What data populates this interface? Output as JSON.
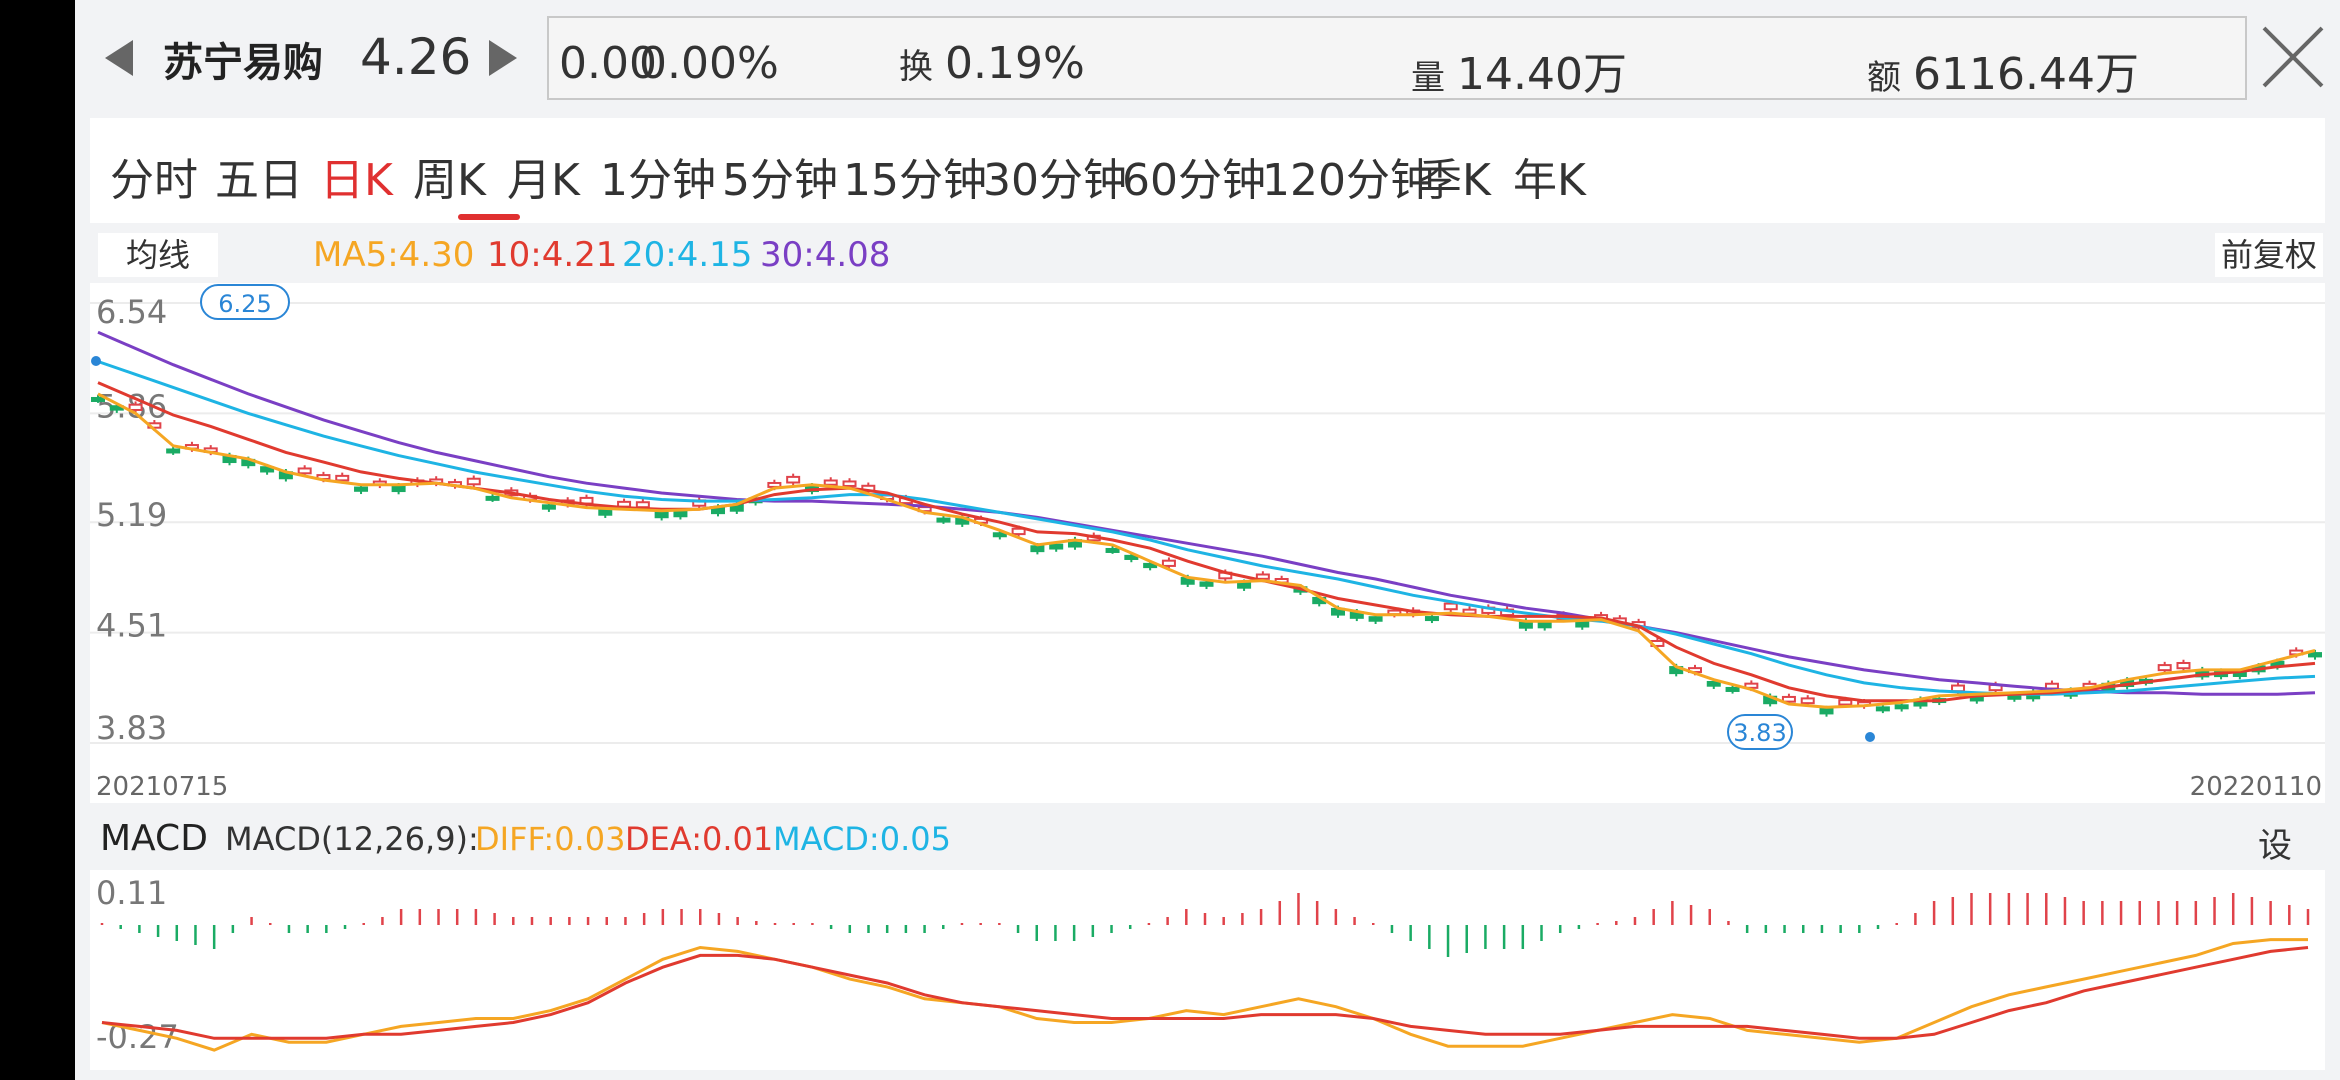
{
  "header": {
    "stock_name": "苏宁易购",
    "price": "4.26",
    "change": "0.00",
    "change_pct": "0.00%",
    "turnover_label": "换",
    "turnover": "0.19%",
    "volume_label": "量",
    "volume": "14.40万",
    "amount_label": "额",
    "amount": "6116.44万"
  },
  "tabs": [
    {
      "label": "分时"
    },
    {
      "label": "五日"
    },
    {
      "label": "日K"
    },
    {
      "label": "周K"
    },
    {
      "label": "月K"
    },
    {
      "label": "1分钟"
    },
    {
      "label": "5分钟"
    },
    {
      "label": "15分钟"
    },
    {
      "label": "30分钟"
    },
    {
      "label": "60分钟"
    },
    {
      "label": "120分钟"
    },
    {
      "label": "季K"
    },
    {
      "label": "年K"
    }
  ],
  "active_tab": "日K",
  "ma_legend": {
    "button": "均线",
    "ma5": "MA5:4.30",
    "ma10": "10:4.21",
    "ma20": "20:4.15",
    "ma30": "30:4.08",
    "adjust": "前复权"
  },
  "colors": {
    "ma5": "#f5a623",
    "ma10": "#e03a2f",
    "ma20": "#1eb4e4",
    "ma30": "#7a3fc4",
    "up": "#e0434a",
    "down": "#1aab64",
    "diff": "#f5a623",
    "dea": "#e03a2f",
    "macd": "#1eb4e4"
  },
  "macd_legend": {
    "title": "MACD",
    "params": "MACD(12,26,9):",
    "diff": "DIFF:0.03",
    "dea": "DEA:0.01",
    "macd": "MACD:0.05",
    "settings": "设置"
  },
  "chart_data": {
    "type": "candlestick",
    "y_ticks": [
      "6.54",
      "5.86",
      "5.19",
      "4.51",
      "3.83"
    ],
    "ylim": [
      3.83,
      6.54
    ],
    "x_start": "20210715",
    "x_end": "20220110",
    "max_marker": "6.25",
    "min_marker": "3.83",
    "ma5": [
      5.98,
      5.86,
      5.66,
      5.62,
      5.58,
      5.5,
      5.45,
      5.42,
      5.42,
      5.43,
      5.4,
      5.34,
      5.31,
      5.28,
      5.27,
      5.26,
      5.27,
      5.3,
      5.4,
      5.42,
      5.4,
      5.33,
      5.25,
      5.22,
      5.14,
      5.05,
      5.08,
      5.05,
      4.95,
      4.85,
      4.82,
      4.83,
      4.8,
      4.66,
      4.62,
      4.62,
      4.63,
      4.61,
      4.58,
      4.58,
      4.59,
      4.52,
      4.3,
      4.22,
      4.16,
      4.07,
      4.05,
      4.06,
      4.08,
      4.12,
      4.13,
      4.14,
      4.15,
      4.17,
      4.22,
      4.26,
      4.28,
      4.28,
      4.34,
      4.4
    ],
    "ma10": [
      6.05,
      5.95,
      5.85,
      5.78,
      5.7,
      5.62,
      5.56,
      5.5,
      5.46,
      5.43,
      5.4,
      5.37,
      5.33,
      5.3,
      5.28,
      5.27,
      5.27,
      5.3,
      5.36,
      5.39,
      5.4,
      5.37,
      5.3,
      5.24,
      5.19,
      5.13,
      5.12,
      5.08,
      5.03,
      4.95,
      4.88,
      4.83,
      4.78,
      4.72,
      4.68,
      4.64,
      4.62,
      4.61,
      4.61,
      4.61,
      4.6,
      4.55,
      4.42,
      4.32,
      4.25,
      4.17,
      4.12,
      4.09,
      4.09,
      4.09,
      4.12,
      4.13,
      4.14,
      4.16,
      4.19,
      4.22,
      4.25,
      4.27,
      4.3,
      4.32
    ],
    "ma20": [
      6.18,
      6.1,
      6.02,
      5.94,
      5.86,
      5.79,
      5.72,
      5.66,
      5.6,
      5.55,
      5.5,
      5.46,
      5.42,
      5.38,
      5.35,
      5.33,
      5.32,
      5.32,
      5.33,
      5.34,
      5.36,
      5.36,
      5.33,
      5.29,
      5.25,
      5.21,
      5.17,
      5.13,
      5.08,
      5.02,
      4.97,
      4.92,
      4.88,
      4.84,
      4.79,
      4.74,
      4.7,
      4.66,
      4.63,
      4.6,
      4.58,
      4.55,
      4.5,
      4.44,
      4.38,
      4.31,
      4.25,
      4.2,
      4.17,
      4.15,
      4.14,
      4.13,
      4.13,
      4.14,
      4.15,
      4.17,
      4.19,
      4.21,
      4.23,
      4.24
    ],
    "ma30": [
      6.36,
      6.26,
      6.16,
      6.07,
      5.98,
      5.9,
      5.82,
      5.75,
      5.68,
      5.62,
      5.57,
      5.52,
      5.47,
      5.43,
      5.4,
      5.37,
      5.35,
      5.33,
      5.32,
      5.32,
      5.31,
      5.3,
      5.29,
      5.27,
      5.25,
      5.22,
      5.18,
      5.14,
      5.1,
      5.06,
      5.02,
      4.98,
      4.93,
      4.88,
      4.84,
      4.79,
      4.74,
      4.7,
      4.66,
      4.63,
      4.59,
      4.55,
      4.51,
      4.46,
      4.41,
      4.36,
      4.32,
      4.28,
      4.25,
      4.22,
      4.2,
      4.18,
      4.16,
      4.15,
      4.14,
      4.14,
      4.13,
      4.13,
      4.13,
      4.14
    ],
    "macd_ylim": [
      -0.27,
      0.11
    ],
    "macd_y_ticks": [
      "0.11",
      "-0.27"
    ],
    "diff": [
      -0.18,
      -0.2,
      -0.22,
      -0.25,
      -0.21,
      -0.23,
      -0.23,
      -0.21,
      -0.19,
      -0.18,
      -0.17,
      -0.17,
      -0.15,
      -0.12,
      -0.07,
      -0.02,
      0.01,
      0.0,
      -0.02,
      -0.04,
      -0.07,
      -0.09,
      -0.12,
      -0.13,
      -0.14,
      -0.17,
      -0.18,
      -0.18,
      -0.17,
      -0.15,
      -0.16,
      -0.14,
      -0.12,
      -0.14,
      -0.17,
      -0.21,
      -0.24,
      -0.24,
      -0.24,
      -0.22,
      -0.2,
      -0.18,
      -0.16,
      -0.17,
      -0.2,
      -0.21,
      -0.22,
      -0.23,
      -0.22,
      -0.18,
      -0.14,
      -0.11,
      -0.09,
      -0.07,
      -0.05,
      -0.03,
      -0.01,
      0.02,
      0.03,
      0.03
    ],
    "dea": [
      -0.18,
      -0.19,
      -0.2,
      -0.22,
      -0.22,
      -0.22,
      -0.22,
      -0.21,
      -0.21,
      -0.2,
      -0.19,
      -0.18,
      -0.16,
      -0.13,
      -0.08,
      -0.04,
      -0.01,
      -0.01,
      -0.02,
      -0.04,
      -0.06,
      -0.08,
      -0.11,
      -0.13,
      -0.14,
      -0.15,
      -0.16,
      -0.17,
      -0.17,
      -0.17,
      -0.17,
      -0.16,
      -0.16,
      -0.16,
      -0.17,
      -0.19,
      -0.2,
      -0.21,
      -0.21,
      -0.21,
      -0.2,
      -0.19,
      -0.19,
      -0.19,
      -0.19,
      -0.2,
      -0.21,
      -0.22,
      -0.22,
      -0.21,
      -0.18,
      -0.15,
      -0.13,
      -0.1,
      -0.08,
      -0.06,
      -0.04,
      -0.02,
      0.0,
      0.01
    ]
  }
}
